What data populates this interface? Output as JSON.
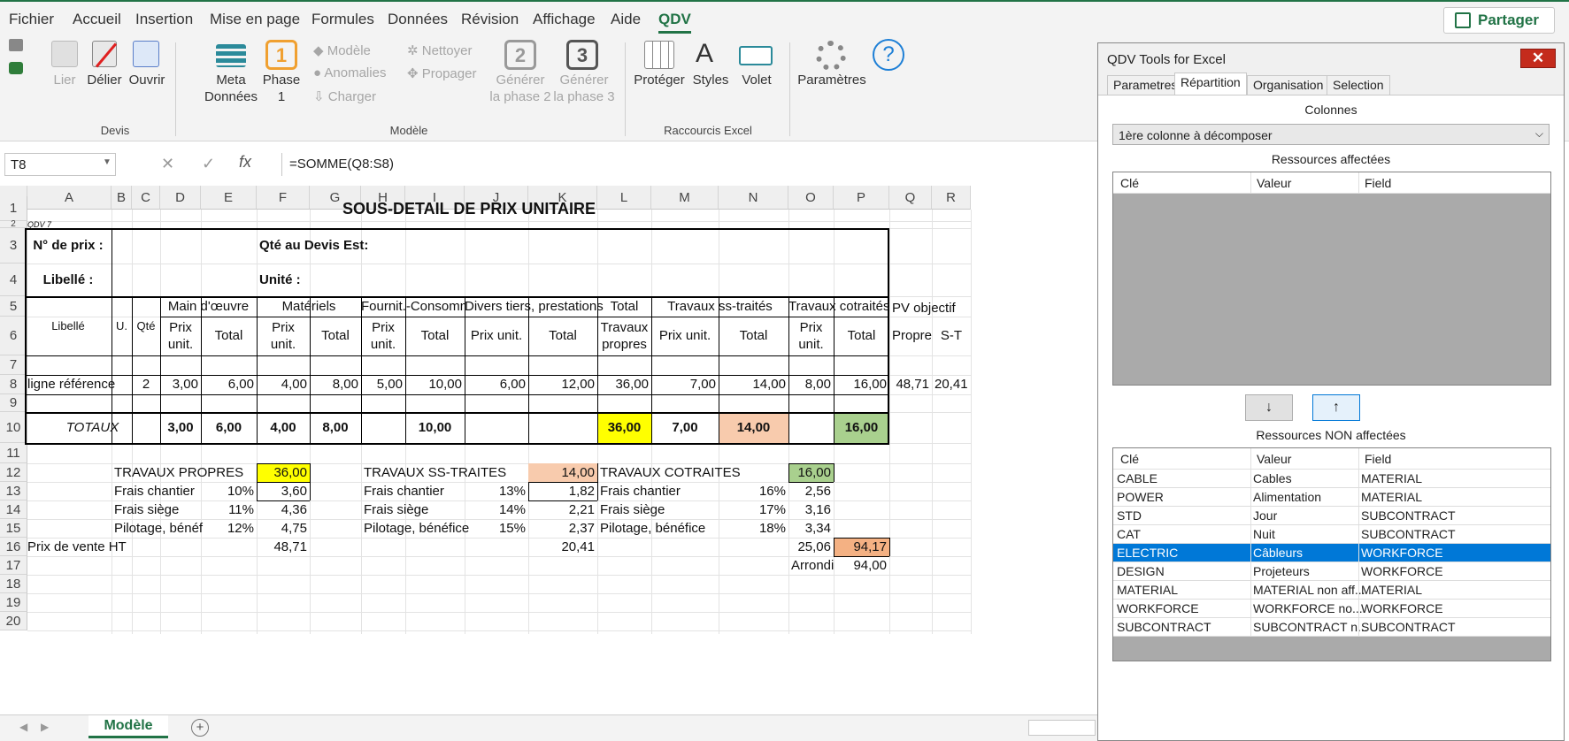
{
  "menu": [
    "Fichier",
    "Accueil",
    "Insertion",
    "Mise en page",
    "Formules",
    "Données",
    "Révision",
    "Affichage",
    "Aide",
    "QDV"
  ],
  "share": "Partager",
  "ribbon": {
    "lier": "Lier",
    "delier": "Délier",
    "ouvrir": "Ouvrir",
    "devis_group": "Devis",
    "meta": "Meta",
    "donnees": "Données",
    "phase": "Phase",
    "phase1": "1",
    "modele": "Modèle",
    "anomalies": "Anomalies",
    "charger": "Charger",
    "nettoyer": "Nettoyer",
    "propager": "Propager",
    "gen2a": "Générer",
    "gen2b": "la phase 2",
    "gen3a": "Générer",
    "gen3b": "la phase 3",
    "num2": "2",
    "num3": "3",
    "modele_group": "Modèle",
    "proteger": "Protéger",
    "styles": "Styles",
    "volet": "Volet",
    "raccourcis_group": "Raccourcis Excel",
    "parametres": "Paramètres"
  },
  "formula_bar": {
    "cell": "T8",
    "formula": "=SOMME(Q8:S8)"
  },
  "columns": [
    "A",
    "B",
    "C",
    "D",
    "E",
    "F",
    "G",
    "H",
    "I",
    "J",
    "K",
    "L",
    "M",
    "N",
    "O",
    "P",
    "Q",
    "R"
  ],
  "rows": [
    "1",
    "2",
    "3",
    "4",
    "5",
    "6",
    "7",
    "8",
    "9",
    "10",
    "11",
    "12",
    "13",
    "14",
    "15",
    "16",
    "17",
    "18",
    "19",
    "20"
  ],
  "sheet": {
    "title": "SOUS-DETAIL DE PRIX UNITAIRE",
    "qdv": "QDV 7",
    "no_prix": "N° de prix :",
    "qte_devis": "Qté au Devis Est:",
    "libelle_label": "Libellé :",
    "unite": "Unité :",
    "h_libelle": "Libellé",
    "h_u": "U.",
    "h_qte": "Qté",
    "h_mo": "Main d'œuvre",
    "h_mat": "Matériels",
    "h_fourn": "Fournit.-Consomm",
    "h_divers": "Divers tiers, prestations",
    "h_total": "Total",
    "h_travaux": "Travaux",
    "h_propres": "propres",
    "h_ss": "Travaux ss-traités",
    "h_cot": "Travaux cotraités",
    "h_pv": "PV objectif",
    "h_propre": "Propre",
    "h_st": "S-T",
    "prix": "Prix",
    "unit": "unit.",
    "total": "Total",
    "prix_unit": "Prix unit.",
    "row8": {
      "label": "ligne référence",
      "qte": "2",
      "d": "3,00",
      "e": "6,00",
      "f": "4,00",
      "g": "8,00",
      "h": "5,00",
      "i": "10,00",
      "j": "6,00",
      "k": "12,00",
      "l": "36,00",
      "m": "7,00",
      "n": "14,00",
      "o": "8,00",
      "p": "16,00",
      "q": "48,71",
      "r": "20,41"
    },
    "totaux": {
      "label": "TOTAUX",
      "d": "3,00",
      "e": "6,00",
      "f": "4,00",
      "g": "8,00",
      "i": "10,00",
      "l": "36,00",
      "m": "7,00",
      "n": "14,00",
      "p": "16,00"
    },
    "recap": {
      "tp": "TRAVAUX PROPRES",
      "tp_val": "36,00",
      "tst": "TRAVAUX SS-TRAITES",
      "tst_val": "14,00",
      "tc": "TRAVAUX COTRAITES",
      "tc_val": "16,00",
      "fc": "Frais chantier",
      "fs": "Frais siège",
      "pil1": "Pilotage, bénéf",
      "pil2": "Pilotage, bénéfice",
      "pil3": "Pilotage, bénéfice",
      "p10": "10%",
      "p11": "11%",
      "p12": "12%",
      "v13a": "3,60",
      "v14a": "4,36",
      "v15a": "4,75",
      "p13": "13%",
      "p14": "14%",
      "p15": "15%",
      "v13b": "1,82",
      "v14b": "2,21",
      "v15b": "2,37",
      "p16": "16%",
      "p17": "17%",
      "p18": "18%",
      "v13c": "2,56",
      "v14c": "3,16",
      "v15c": "3,34",
      "pv": "Prix de vente HT",
      "pv1": "48,71",
      "pv2": "20,41",
      "pv3": "25,06",
      "pv_total": "94,17",
      "arrondi": "Arrondi",
      "arrondi_val": "94,00"
    }
  },
  "sheet_tab": "Modèle",
  "colors": {
    "yellow": "#ffff00",
    "peach": "#f8cbad",
    "green": "#a9d08e",
    "orange": "#f4b183",
    "accent": "#217346"
  },
  "panel": {
    "title": "QDV Tools for Excel",
    "close": "✕",
    "tabs": [
      "Parametres",
      "Répartition",
      "Organisation",
      "Selection"
    ],
    "colonnes": "Colonnes",
    "combo": "1ère colonne à décomposer",
    "aff_label": "Ressources affectées",
    "non_aff_label": "Ressources NON affectées",
    "headers": [
      "Clé",
      "Valeur",
      "Field"
    ],
    "down": "↓",
    "up": "↑",
    "rows": [
      [
        "CABLE",
        "Cables",
        "MATERIAL"
      ],
      [
        "POWER",
        "Alimentation",
        "MATERIAL"
      ],
      [
        "STD",
        "Jour",
        "SUBCONTRACT"
      ],
      [
        "CAT",
        "Nuit",
        "SUBCONTRACT"
      ],
      [
        "ELECTRIC",
        "Câbleurs",
        "WORKFORCE"
      ],
      [
        "DESIGN",
        "Projeteurs",
        "WORKFORCE"
      ],
      [
        "MATERIAL",
        "MATERIAL non aff...",
        "MATERIAL"
      ],
      [
        "WORKFORCE",
        "WORKFORCE no...",
        "WORKFORCE"
      ],
      [
        "SUBCONTRACT",
        "SUBCONTRACT n...",
        "SUBCONTRACT"
      ]
    ],
    "selected_row": "ELECTRIC"
  }
}
